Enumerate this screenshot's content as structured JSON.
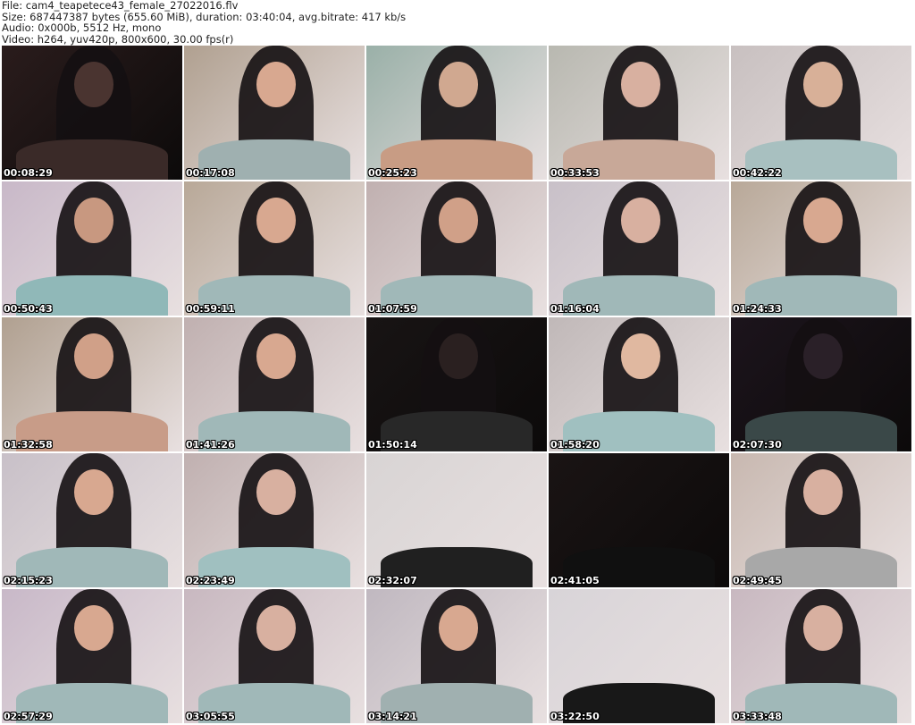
{
  "info": {
    "file": "File: cam4_teapetece43_female_27022016.flv",
    "size": "Size: 687447387 bytes (655.60 MiB), duration: 03:40:04, avg.bitrate: 417 kb/s",
    "audio": "Audio: 0x000b, 5512 Hz, mono",
    "video": "Video: h264, yuv420p, 800x600, 30.00 fps(r)"
  },
  "thumbnails": [
    {
      "time": "00:08:29",
      "bg": "#2a1c1c",
      "face": "#4a3430",
      "shirt": "#3a2a28"
    },
    {
      "time": "00:17:08",
      "bg": "#b0a090",
      "face": "#d8a890",
      "shirt": "#9fb0b0"
    },
    {
      "time": "00:25:23",
      "bg": "#9ab0a8",
      "face": "#d0a890",
      "shirt": "#c89c84"
    },
    {
      "time": "00:33:53",
      "bg": "#b8b8b0",
      "face": "#d8b0a0",
      "shirt": "#c8a898"
    },
    {
      "time": "00:42:22",
      "bg": "#c8c0c0",
      "face": "#d8b098",
      "shirt": "#a8c0c0"
    },
    {
      "time": "00:50:43",
      "bg": "#c8b8c8",
      "face": "#c89880",
      "shirt": "#90b8b8"
    },
    {
      "time": "00:59:11",
      "bg": "#b8a898",
      "face": "#d8a890",
      "shirt": "#a0b8b8"
    },
    {
      "time": "01:07:59",
      "bg": "#c0b0b0",
      "face": "#d0a088",
      "shirt": "#a0b8b8"
    },
    {
      "time": "01:16:04",
      "bg": "#c8c0c8",
      "face": "#d8b0a0",
      "shirt": "#a0b8b8"
    },
    {
      "time": "01:24:33",
      "bg": "#b8a898",
      "face": "#d8a890",
      "shirt": "#a0b8b8"
    },
    {
      "time": "01:32:58",
      "bg": "#b0a090",
      "face": "#d0a088",
      "shirt": "#c89c88"
    },
    {
      "time": "01:41:26",
      "bg": "#c0b0b0",
      "face": "#d8a890",
      "shirt": "#a0b8b8"
    },
    {
      "time": "01:50:14",
      "bg": "#181414",
      "face": "#2a2020",
      "shirt": "#282828"
    },
    {
      "time": "01:58:20",
      "bg": "#c0b8b8",
      "face": "#e0b8a0",
      "shirt": "#a0c0c0"
    },
    {
      "time": "02:07:30",
      "bg": "#1c141c",
      "face": "#2a2028",
      "shirt": "#3a4848"
    },
    {
      "time": "02:15:23",
      "bg": "#c8c0c8",
      "face": "#d8a890",
      "shirt": "#a0b8b8"
    },
    {
      "time": "02:23:49",
      "bg": "#c0b0b0",
      "face": "#d8b0a0",
      "shirt": "#a0c0c0"
    },
    {
      "time": "02:32:07",
      "bg": "#d8d4d4",
      "face": "#d8d4d4",
      "shirt": "#202020"
    },
    {
      "time": "02:41:05",
      "bg": "#1a1414",
      "face": "#1a1414",
      "shirt": "#101010"
    },
    {
      "time": "02:49:45",
      "bg": "#c8b8b0",
      "face": "#d8b0a0",
      "shirt": "#a8a8a8"
    },
    {
      "time": "02:57:29",
      "bg": "#c8b8c8",
      "face": "#d8a890",
      "shirt": "#a0b8b8"
    },
    {
      "time": "03:05:55",
      "bg": "#c8b8c0",
      "face": "#d8b0a0",
      "shirt": "#a0b8b8"
    },
    {
      "time": "03:14:21",
      "bg": "#c0b8c0",
      "face": "#d8a890",
      "shirt": "#a0b0b0"
    },
    {
      "time": "03:22:50",
      "bg": "#d8d4d8",
      "face": "#d8d4d8",
      "shirt": "#181818"
    },
    {
      "time": "03:33:48",
      "bg": "#c8b8c0",
      "face": "#d8b0a0",
      "shirt": "#a0b8b8"
    }
  ]
}
